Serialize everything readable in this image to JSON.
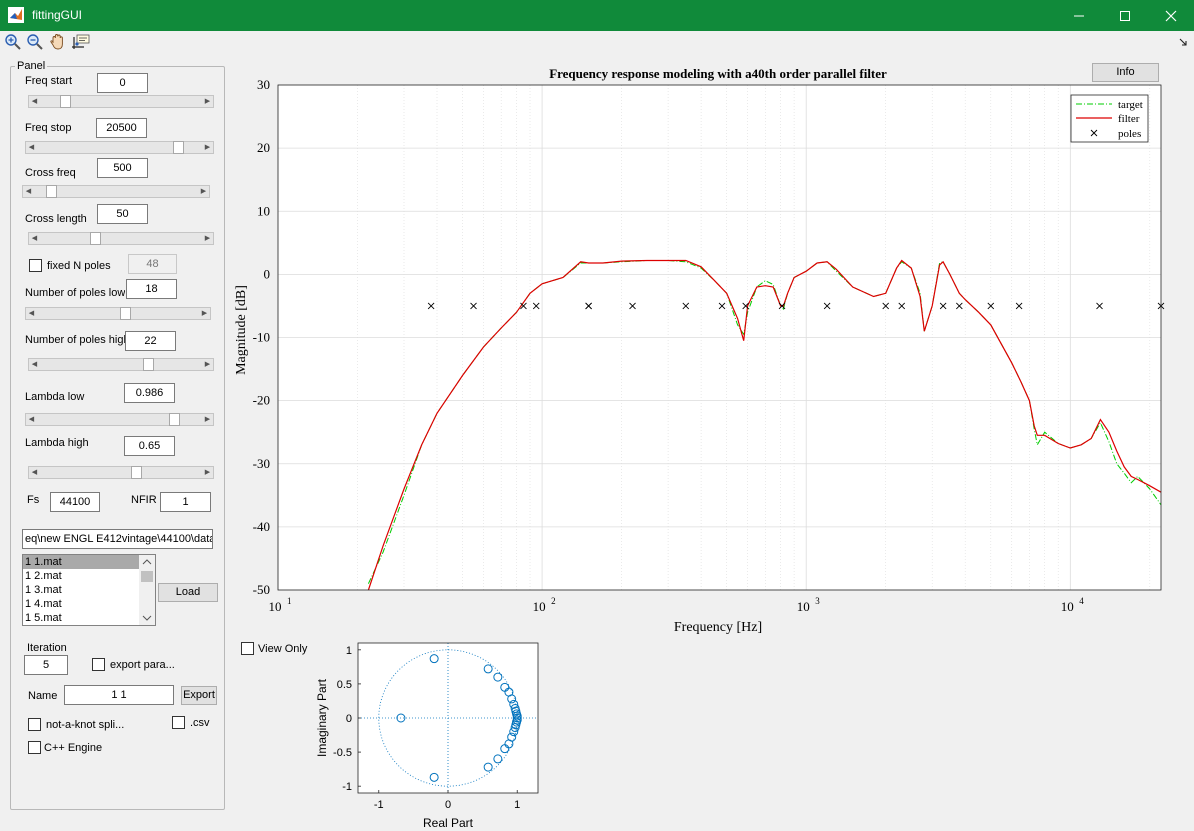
{
  "window": {
    "title": "fittingGUI"
  },
  "toolbar": {
    "icons": [
      "zoom-in-icon",
      "zoom-out-icon",
      "pan-icon",
      "data-cursor-icon"
    ]
  },
  "panel": {
    "title": "Panel",
    "freq_start": {
      "label": "Freq start",
      "value": "0",
      "slider_fraction": 0.13
    },
    "freq_stop": {
      "label": "Freq stop",
      "value": "20500",
      "slider_fraction": 0.88
    },
    "cross_freq": {
      "label": "Cross freq",
      "value": "500",
      "slider_fraction": 0.08
    },
    "cross_length": {
      "label": "Cross length",
      "value": "50",
      "slider_fraction": 0.33
    },
    "fixed_n_poles": {
      "label": "fixed N poles",
      "value": "48",
      "checked": false
    },
    "poles_low": {
      "label": "Number of poles low",
      "value": "18",
      "slider_fraction": 0.55
    },
    "poles_high": {
      "label": "Number of poles high",
      "value": "22",
      "slider_fraction": 0.68
    },
    "lambda_low": {
      "label": "Lambda low",
      "value": "0.986",
      "slider_fraction": 0.86
    },
    "lambda_high": {
      "label": "Lambda high",
      "value": "0.65",
      "slider_fraction": 0.6
    },
    "fs": {
      "label": "Fs",
      "value": "44100"
    },
    "nfir": {
      "label": "NFIR",
      "value": "1"
    },
    "path": "eq\\new ENGL E412vintage\\44100\\data",
    "files": [
      "1 1.mat",
      "1 2.mat",
      "1 3.mat",
      "1 4.mat",
      "1 5.mat"
    ],
    "selected_file": "1 1.mat",
    "load_label": "Load",
    "iteration": {
      "label": "Iteration",
      "value": "5"
    },
    "export_params": {
      "label": "export para...",
      "checked": false
    },
    "name": {
      "label": "Name",
      "value": "1 1"
    },
    "export_label": "Export",
    "not_a_knot": {
      "label": "not-a-knot spli...",
      "checked": false
    },
    "csv": {
      "label": ".csv",
      "checked": false
    },
    "cpp_engine": {
      "label": "C++ Engine",
      "checked": false
    }
  },
  "info_label": "Info",
  "view_only": {
    "label": "View Only",
    "checked": false
  },
  "colors": {
    "titlebar": "#108a3a",
    "target": "#00cc00",
    "filter": "#dd0000",
    "zplane": "#0072bd"
  },
  "chart_data": [
    {
      "type": "line",
      "title": "Frequency response modeling with a40th order parallel filter",
      "xlabel": "Frequency [Hz]",
      "ylabel": "Magnitude [dB]",
      "xscale": "log",
      "xlim": [
        10,
        22050
      ],
      "ylim": [
        -50,
        30
      ],
      "yticks": [
        30,
        20,
        10,
        0,
        -10,
        -20,
        -30,
        -40,
        -50
      ],
      "xticks": [
        {
          "base": "10",
          "exp": "1",
          "value": 10
        },
        {
          "base": "10",
          "exp": "2",
          "value": 100
        },
        {
          "base": "10",
          "exp": "3",
          "value": 1000
        },
        {
          "base": "10",
          "exp": "4",
          "value": 10000
        }
      ],
      "grid": true,
      "legend_position": "top-right",
      "legend": [
        "target",
        "filter",
        "poles"
      ],
      "series": [
        {
          "name": "target",
          "style": "dash-dot",
          "x": [
            22,
            25,
            30,
            35,
            40,
            50,
            60,
            70,
            80,
            90,
            100,
            120,
            140,
            150,
            170,
            200,
            250,
            300,
            350,
            400,
            450,
            500,
            550,
            580,
            600,
            650,
            700,
            750,
            800,
            820,
            850,
            900,
            1000,
            1100,
            1200,
            1300,
            1500,
            1800,
            2000,
            2200,
            2300,
            2500,
            2700,
            2800,
            3000,
            3200,
            3300,
            3500,
            3800,
            4000,
            4500,
            5000,
            6000,
            6500,
            7000,
            7300,
            7500,
            8000,
            9000,
            10000,
            11000,
            12000,
            13000,
            14000,
            15000,
            16000,
            17000,
            18000,
            19000,
            20000,
            22050
          ],
          "y": [
            -49,
            -44,
            -35,
            -27,
            -22,
            -16,
            -11.5,
            -8.5,
            -6,
            -3,
            -1.5,
            -0.5,
            1.8,
            1.8,
            1.8,
            2,
            2.2,
            2.2,
            2,
            1,
            -1,
            -3,
            -8,
            -9.5,
            -6,
            -2,
            -1,
            -1.6,
            -5,
            -5.5,
            -3,
            -0.5,
            0.5,
            1.8,
            2,
            0.5,
            -2,
            -3.5,
            -3,
            1,
            2,
            1,
            -3,
            -9,
            -5,
            1.8,
            2,
            0,
            -3,
            -4,
            -6,
            -8,
            -14,
            -17,
            -20,
            -24.5,
            -27,
            -25,
            -26.8,
            -27.5,
            -27,
            -26,
            -23.5,
            -26.5,
            -30,
            -31.5,
            -33,
            -32,
            -33,
            -34,
            -36.5
          ]
        },
        {
          "name": "filter",
          "style": "solid",
          "x": [
            22,
            25,
            30,
            35,
            40,
            50,
            60,
            70,
            80,
            90,
            100,
            120,
            140,
            150,
            170,
            200,
            250,
            300,
            350,
            400,
            450,
            500,
            550,
            580,
            600,
            650,
            700,
            750,
            800,
            820,
            850,
            900,
            1000,
            1100,
            1200,
            1300,
            1500,
            1800,
            2000,
            2200,
            2300,
            2500,
            2700,
            2800,
            3000,
            3200,
            3300,
            3500,
            3800,
            4000,
            4500,
            5000,
            6000,
            6500,
            7000,
            7300,
            7500,
            8000,
            9000,
            10000,
            11000,
            12000,
            13000,
            14000,
            15000,
            16000,
            17000,
            18000,
            19000,
            20000,
            22050
          ],
          "y": [
            -50,
            -43,
            -34,
            -27,
            -22,
            -16,
            -11.5,
            -8.5,
            -6,
            -3,
            -1.5,
            -0.5,
            2,
            1.8,
            1.8,
            2.1,
            2.2,
            2.2,
            2.2,
            1.2,
            -1,
            -3,
            -7,
            -10.5,
            -5,
            -2,
            -1.8,
            -2,
            -5,
            -5,
            -3,
            -0.5,
            0.5,
            1.8,
            2,
            0.8,
            -2,
            -3.5,
            -3,
            1,
            2.2,
            1,
            -3.5,
            -9,
            -5,
            1.5,
            2,
            0,
            -3,
            -4,
            -6,
            -8,
            -14,
            -17,
            -20,
            -24,
            -25.5,
            -25.5,
            -26.8,
            -27.5,
            -27,
            -26,
            -23,
            -25,
            -28,
            -30.5,
            -32,
            -32.5,
            -33,
            -33.5,
            -34.5
          ]
        }
      ],
      "poles": {
        "y": -5,
        "x": [
          38,
          55,
          85,
          95,
          150,
          150,
          220,
          350,
          480,
          590,
          810,
          1200,
          2000,
          2300,
          3300,
          3800,
          5000,
          6400,
          12900,
          22050
        ]
      }
    },
    {
      "type": "scatter",
      "xlabel": "Real Part",
      "ylabel": "Imaginary Part",
      "xlim": [
        -1.3,
        1.3
      ],
      "ylim": [
        -1.1,
        1.1
      ],
      "xticks": [
        "-1",
        "0",
        "1"
      ],
      "yticks": [
        "1",
        "0.5",
        "0",
        "-0.5",
        "-1"
      ],
      "unit_circle": true,
      "points": [
        [
          -0.2,
          0.87
        ],
        [
          -0.2,
          -0.87
        ],
        [
          -0.68,
          0
        ],
        [
          0.58,
          0.72
        ],
        [
          0.58,
          -0.72
        ],
        [
          0.72,
          0.6
        ],
        [
          0.72,
          -0.6
        ],
        [
          0.82,
          0.45
        ],
        [
          0.82,
          -0.45
        ],
        [
          0.88,
          0.38
        ],
        [
          0.88,
          -0.38
        ],
        [
          0.92,
          0.28
        ],
        [
          0.92,
          -0.28
        ],
        [
          0.95,
          0.2
        ],
        [
          0.95,
          -0.2
        ],
        [
          0.97,
          0.14
        ],
        [
          0.97,
          -0.14
        ],
        [
          0.98,
          0.1
        ],
        [
          0.98,
          -0.1
        ],
        [
          0.99,
          0.06
        ],
        [
          0.99,
          -0.06
        ],
        [
          1.0,
          0.03
        ],
        [
          1.0,
          -0.03
        ],
        [
          1.0,
          0
        ]
      ]
    }
  ]
}
